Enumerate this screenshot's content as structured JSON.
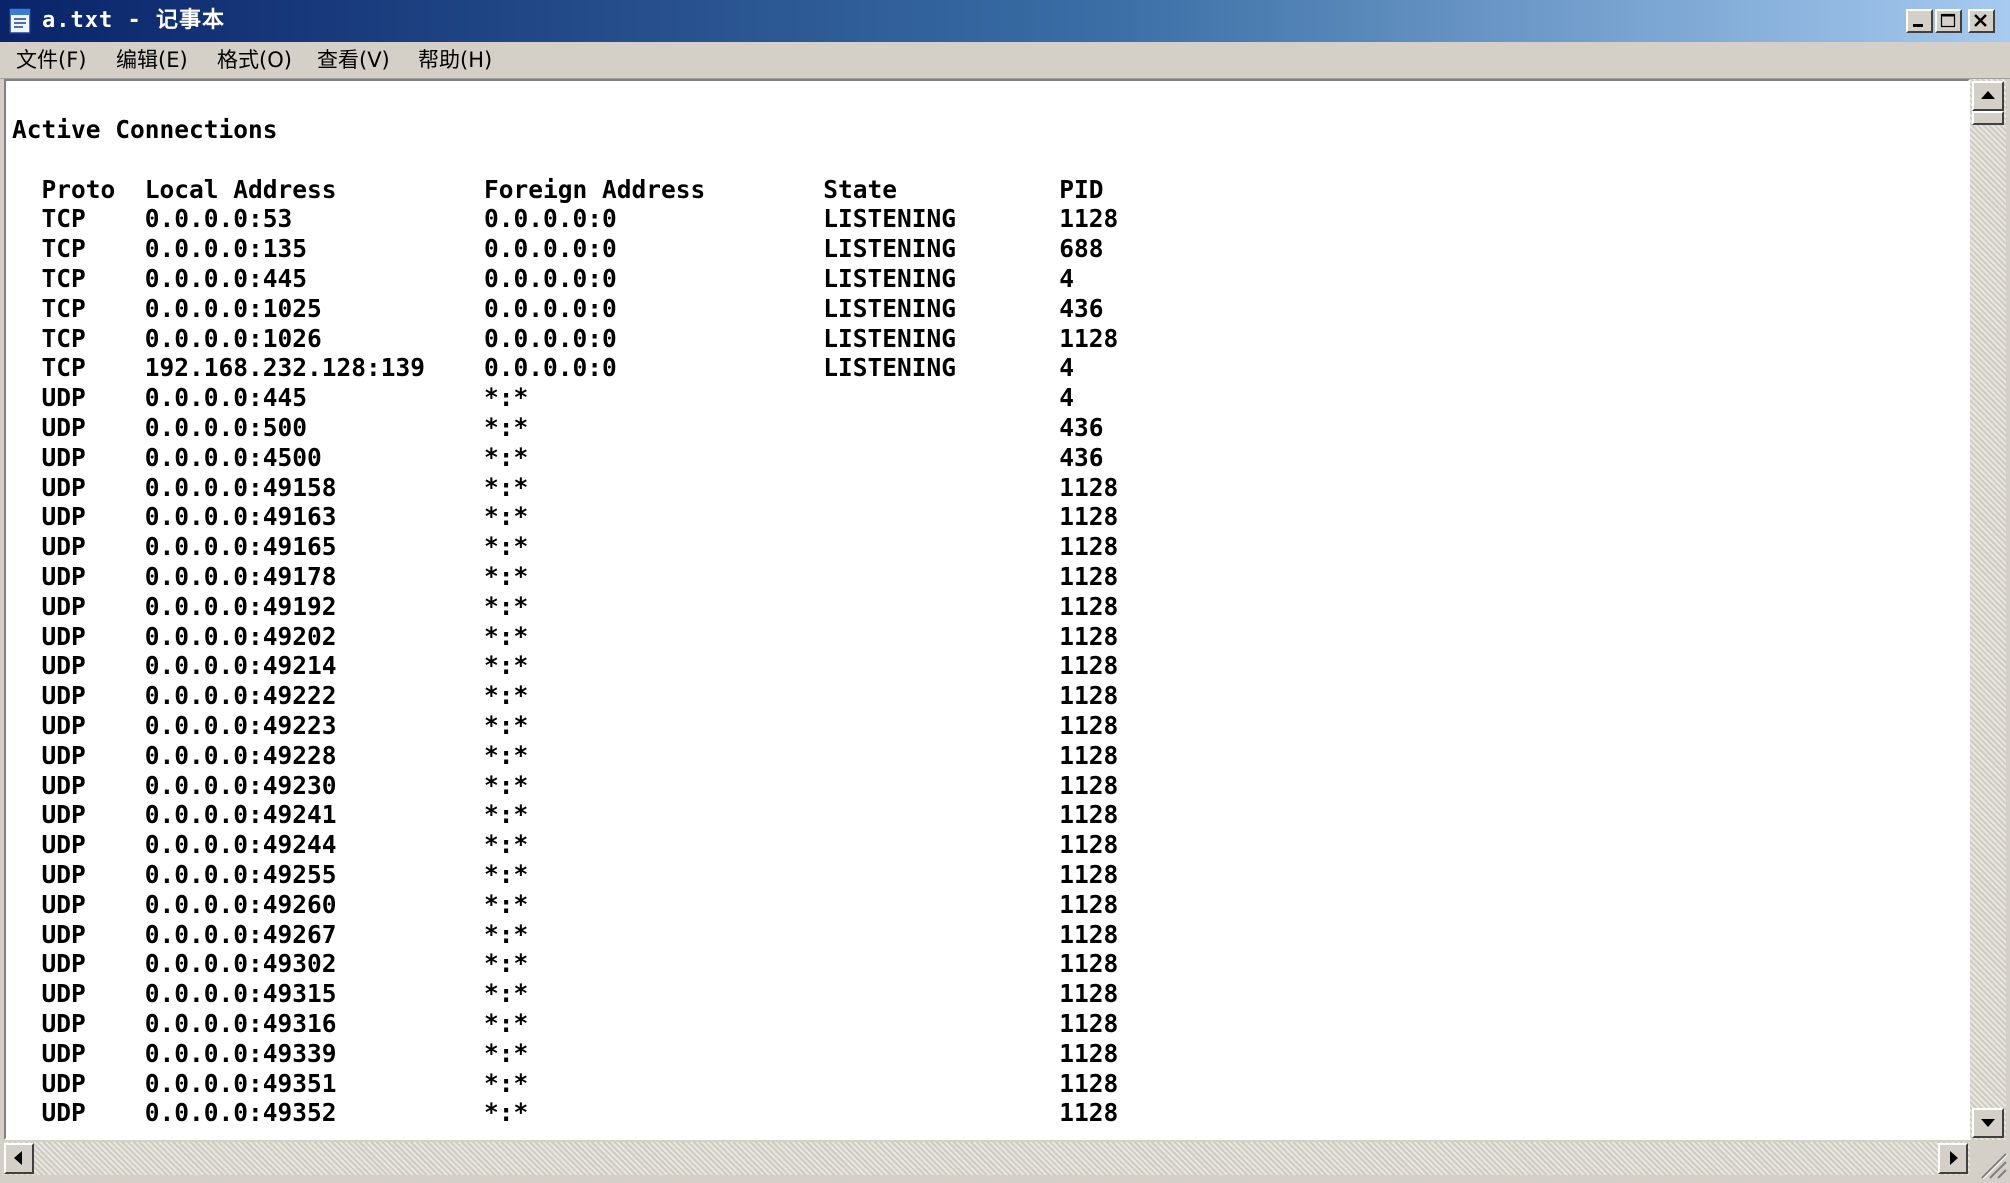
{
  "window": {
    "title": "a.txt - 记事本",
    "icon": "notepad-icon"
  },
  "menu": {
    "file": "文件(F)",
    "edit": "编辑(E)",
    "format": "格式(O)",
    "view": "查看(V)",
    "help": "帮助(H)"
  },
  "document": {
    "heading": "Active Connections",
    "columns": [
      "Proto",
      "Local Address",
      "Foreign Address",
      "State",
      "PID"
    ],
    "rows": [
      [
        "TCP",
        "0.0.0.0:53",
        "0.0.0.0:0",
        "LISTENING",
        "1128"
      ],
      [
        "TCP",
        "0.0.0.0:135",
        "0.0.0.0:0",
        "LISTENING",
        "688"
      ],
      [
        "TCP",
        "0.0.0.0:445",
        "0.0.0.0:0",
        "LISTENING",
        "4"
      ],
      [
        "TCP",
        "0.0.0.0:1025",
        "0.0.0.0:0",
        "LISTENING",
        "436"
      ],
      [
        "TCP",
        "0.0.0.0:1026",
        "0.0.0.0:0",
        "LISTENING",
        "1128"
      ],
      [
        "TCP",
        "192.168.232.128:139",
        "0.0.0.0:0",
        "LISTENING",
        "4"
      ],
      [
        "UDP",
        "0.0.0.0:445",
        "*:*",
        "",
        "4"
      ],
      [
        "UDP",
        "0.0.0.0:500",
        "*:*",
        "",
        "436"
      ],
      [
        "UDP",
        "0.0.0.0:4500",
        "*:*",
        "",
        "436"
      ],
      [
        "UDP",
        "0.0.0.0:49158",
        "*:*",
        "",
        "1128"
      ],
      [
        "UDP",
        "0.0.0.0:49163",
        "*:*",
        "",
        "1128"
      ],
      [
        "UDP",
        "0.0.0.0:49165",
        "*:*",
        "",
        "1128"
      ],
      [
        "UDP",
        "0.0.0.0:49178",
        "*:*",
        "",
        "1128"
      ],
      [
        "UDP",
        "0.0.0.0:49192",
        "*:*",
        "",
        "1128"
      ],
      [
        "UDP",
        "0.0.0.0:49202",
        "*:*",
        "",
        "1128"
      ],
      [
        "UDP",
        "0.0.0.0:49214",
        "*:*",
        "",
        "1128"
      ],
      [
        "UDP",
        "0.0.0.0:49222",
        "*:*",
        "",
        "1128"
      ],
      [
        "UDP",
        "0.0.0.0:49223",
        "*:*",
        "",
        "1128"
      ],
      [
        "UDP",
        "0.0.0.0:49228",
        "*:*",
        "",
        "1128"
      ],
      [
        "UDP",
        "0.0.0.0:49230",
        "*:*",
        "",
        "1128"
      ],
      [
        "UDP",
        "0.0.0.0:49241",
        "*:*",
        "",
        "1128"
      ],
      [
        "UDP",
        "0.0.0.0:49244",
        "*:*",
        "",
        "1128"
      ],
      [
        "UDP",
        "0.0.0.0:49255",
        "*:*",
        "",
        "1128"
      ],
      [
        "UDP",
        "0.0.0.0:49260",
        "*:*",
        "",
        "1128"
      ],
      [
        "UDP",
        "0.0.0.0:49267",
        "*:*",
        "",
        "1128"
      ],
      [
        "UDP",
        "0.0.0.0:49302",
        "*:*",
        "",
        "1128"
      ],
      [
        "UDP",
        "0.0.0.0:49315",
        "*:*",
        "",
        "1128"
      ],
      [
        "UDP",
        "0.0.0.0:49316",
        "*:*",
        "",
        "1128"
      ],
      [
        "UDP",
        "0.0.0.0:49339",
        "*:*",
        "",
        "1128"
      ],
      [
        "UDP",
        "0.0.0.0:49351",
        "*:*",
        "",
        "1128"
      ],
      [
        "UDP",
        "0.0.0.0:49352",
        "*:*",
        "",
        "1128"
      ]
    ]
  },
  "controls": {
    "minimize_icon": "minimize-icon",
    "maximize_icon": "maximize-icon",
    "close_icon": "close-icon"
  }
}
